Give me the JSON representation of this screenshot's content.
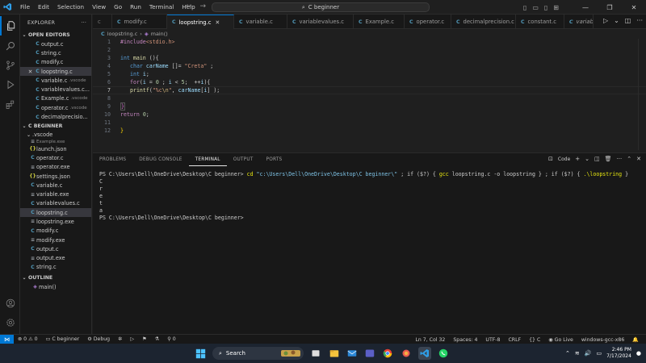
{
  "titlebar": {
    "menu": [
      "File",
      "Edit",
      "Selection",
      "View",
      "Go",
      "Run",
      "Terminal",
      "Help"
    ],
    "command_center": "C beginner"
  },
  "sidebar": {
    "title": "EXPLORER",
    "open_editors_label": "OPEN EDITORS",
    "open_editors": [
      {
        "name": "output.c",
        "type": "c",
        "hint": ""
      },
      {
        "name": "string.c",
        "type": "c",
        "hint": ""
      },
      {
        "name": "modify.c",
        "type": "c",
        "hint": ""
      },
      {
        "name": "loopstring.c",
        "type": "c",
        "hint": "",
        "selected": true
      },
      {
        "name": "variable.c",
        "type": "c",
        "hint": ".vscode"
      },
      {
        "name": "variablevalues.c...",
        "type": "c",
        "hint": ""
      },
      {
        "name": "Example.c",
        "type": "c",
        "hint": ".vscode"
      },
      {
        "name": "operator.c",
        "type": "c",
        "hint": ".vscode"
      },
      {
        "name": "decimalprecisio...",
        "type": "c",
        "hint": ""
      }
    ],
    "folder_label": "C BEGINNER",
    "subfolder_label": ".vscode",
    "files": [
      {
        "name": "Example.exe",
        "type": "e"
      },
      {
        "name": "launch.json",
        "type": "j"
      },
      {
        "name": "operator.c",
        "type": "c"
      },
      {
        "name": "operator.exe",
        "type": "e"
      },
      {
        "name": "settings.json",
        "type": "j"
      },
      {
        "name": "variable.c",
        "type": "c"
      },
      {
        "name": "variable.exe",
        "type": "e"
      },
      {
        "name": "variablevalues.c",
        "type": "c"
      },
      {
        "name": "loopstring.c",
        "type": "c",
        "selected": true
      },
      {
        "name": "loopstring.exe",
        "type": "e"
      },
      {
        "name": "modify.c",
        "type": "c"
      },
      {
        "name": "modify.exe",
        "type": "e"
      },
      {
        "name": "output.c",
        "type": "c"
      },
      {
        "name": "output.exe",
        "type": "e"
      },
      {
        "name": "string.c",
        "type": "c"
      }
    ],
    "outline_label": "OUTLINE",
    "outline_item": "main()"
  },
  "tabs": [
    "modify.c",
    "loopstring.c",
    "variable.c",
    "variablevalues.c",
    "Example.c",
    "operator.c",
    "decimalprecision.c",
    "constant.c",
    "variable.ex"
  ],
  "breadcrumb": {
    "file": "loopstring.c",
    "symbol": "main()"
  },
  "editor": {
    "line_numbers": [
      "1",
      "2",
      "3",
      "4",
      "5",
      "6",
      "7",
      "8",
      "9",
      "10",
      "11",
      "12"
    ],
    "current_line": "7",
    "code": {
      "l1_inc": "#include",
      "l1_hdr": "<stdio.h>",
      "l3_kw": "int",
      "l3_fn": " main ",
      "l3_rest": "(){",
      "l4_kw": "char",
      "l4_var": " carName ",
      "l4_mid": "[]= ",
      "l4_str": "\"Creta\"",
      "l4_end": " ;",
      "l5_kw": "int",
      "l5_var": " i",
      "l5_end": ";",
      "l6_ctl": "for",
      "l6_a": "(",
      "l6_i1": "i",
      "l6_b": " = ",
      "l6_n0": "0",
      "l6_c": " ; ",
      "l6_i2": "i",
      "l6_d": " < ",
      "l6_n5": "5",
      "l6_e": ";  ++",
      "l6_i3": "i",
      "l6_f": "){",
      "l7_fn": "printf",
      "l7_a": "(",
      "l7_str1": "\"%c",
      "l7_esc": "\\n",
      "l7_str2": "\"",
      "l7_b": ", ",
      "l7_var": "carName",
      "l7_c": "[",
      "l7_i": "i",
      "l7_d": "] );",
      "l9": "}",
      "l10_ctl": "return",
      "l10_sp": " ",
      "l10_num": "0",
      "l10_end": ";",
      "l12": "}"
    }
  },
  "panel": {
    "tabs": [
      "PROBLEMS",
      "DEBUG CONSOLE",
      "TERMINAL",
      "OUTPUT",
      "PORTS"
    ],
    "active_tab": "TERMINAL",
    "shell_label": "Code",
    "terminal": {
      "prompt1": "PS C:\\Users\\Dell\\OneDrive\\Desktop\\C beginner> ",
      "cmd_cd": "cd ",
      "cmd_path": "\"c:\\Users\\Dell\\OneDrive\\Desktop\\C beginner\\\"",
      "cmd_mid": " ; if ($?) { ",
      "cmd_gcc": "gcc",
      "cmd_gcc_args": " loopstring.c -o loopstring } ; if ($?) { ",
      "cmd_run": ".\\loopstring",
      "cmd_end": " }",
      "output": [
        "C",
        "r",
        "e",
        "t",
        "a"
      ],
      "prompt2": "PS C:\\Users\\Dell\\OneDrive\\Desktop\\C beginner>"
    }
  },
  "statusbar": {
    "problems": "0",
    "warnings": "0",
    "folder": "C beginner",
    "debug": "Debug",
    "ports": "0",
    "position": "Ln 7, Col 32",
    "spaces": "Spaces: 4",
    "encoding": "UTF-8",
    "eol": "CRLF",
    "language": "C",
    "golive": "Go Live",
    "platform": "windows-gcc-x86"
  },
  "taskbar": {
    "search": "Search",
    "time": "2:46 PM",
    "date": "7/17/2024"
  },
  "colors": {
    "accent": "#0078d4",
    "c_file": "#519aba"
  }
}
